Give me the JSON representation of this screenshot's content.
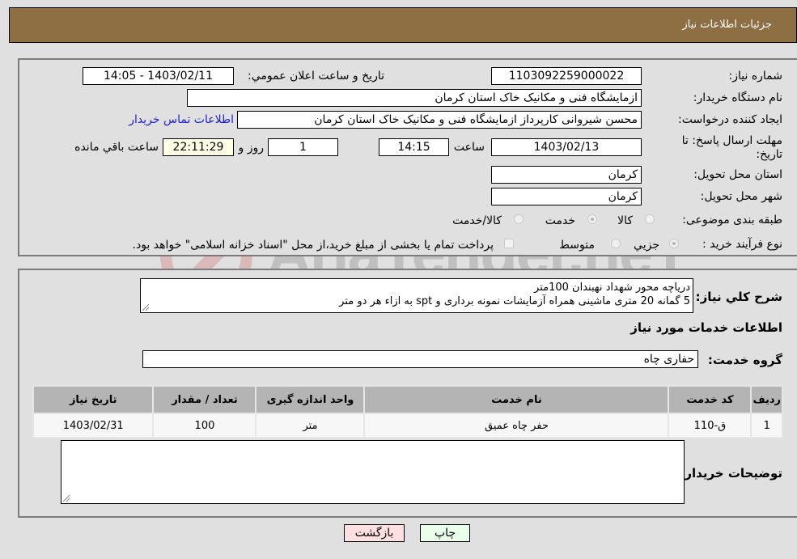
{
  "header": {
    "title": "جزئیات اطلاعات نیاز"
  },
  "fields": {
    "need_number": {
      "label": "شماره نیاز:",
      "value": "1103092259000022"
    },
    "announce_datetime": {
      "label": "تاریخ و ساعت اعلان عمومي:",
      "value": "1403/02/11 - 14:05"
    },
    "buyer_org": {
      "label": "نام دستگاه خريدار:",
      "value": "ازمایشگاه فنی و مکانیک خاک استان کرمان"
    },
    "requester": {
      "label": "ایجاد کننده درخواست:",
      "value": "محسن شیروانی کارپرداز ازمایشگاه فنی و مکانیک خاک استان کرمان"
    },
    "buyer_contact_link": "اطلاعات تماس خریدار",
    "deadline": {
      "label": "مهلت ارسال پاسخ: تا تاریخ:",
      "date": "1403/02/13",
      "time_label": "ساعت",
      "time": "14:15",
      "days": "1",
      "days_label": "روز و",
      "remaining": "22:11:29",
      "remaining_label": "ساعت باقي مانده"
    },
    "delivery_province": {
      "label": "استان محل تحویل:",
      "value": "کرمان"
    },
    "delivery_city": {
      "label": "شهر محل تحویل:",
      "value": "کرمان"
    },
    "category": {
      "label": "طبقه بندی موضوعی:",
      "options": [
        "کالا",
        "خدمت",
        "کالا/خدمت"
      ],
      "selected": "خدمت"
    },
    "purchase_type": {
      "label": "نوع فرآیند خرید :",
      "options": [
        "جزيي",
        "متوسط"
      ],
      "selected": "جزيي",
      "treasury_note": "پرداخت تمام یا بخشی از مبلغ خرید،از محل \"اسناد خزانه اسلامی\" خواهد بود."
    }
  },
  "details": {
    "description_label": "شرح کلي نياز:",
    "description_lines": [
      "دریاچه محور شهداد نهبندان 100متر",
      "5 گمانه 20 متری ماشینی  همراه آزمایشات نمونه برداری و spt به ازاء هر دو متر"
    ],
    "services_heading": "اطلاعات خدمات مورد نياز",
    "service_group_label": "گروه خدمت:",
    "service_group_value": "حفاری چاه",
    "table": {
      "headers": [
        "رديف",
        "کد خدمت",
        "نام خدمت",
        "واحد اندازه گیری",
        "تعداد / مقدار",
        "تاریخ نیاز"
      ],
      "rows": [
        [
          "1",
          "ق-110",
          "حفر چاه عمیق",
          "متر",
          "100",
          "1403/02/31"
        ]
      ]
    },
    "buyer_notes_label": "توضیحات خریدار:",
    "buyer_notes_value": ""
  },
  "buttons": {
    "print": "چاپ",
    "back": "بازگشت"
  },
  "watermark": "AriaTender.neT",
  "colors": {
    "header_bg": "#8e6e43",
    "print_bg": "#eaffea",
    "back_bg": "#ffe0e0",
    "link": "#2020cc"
  }
}
